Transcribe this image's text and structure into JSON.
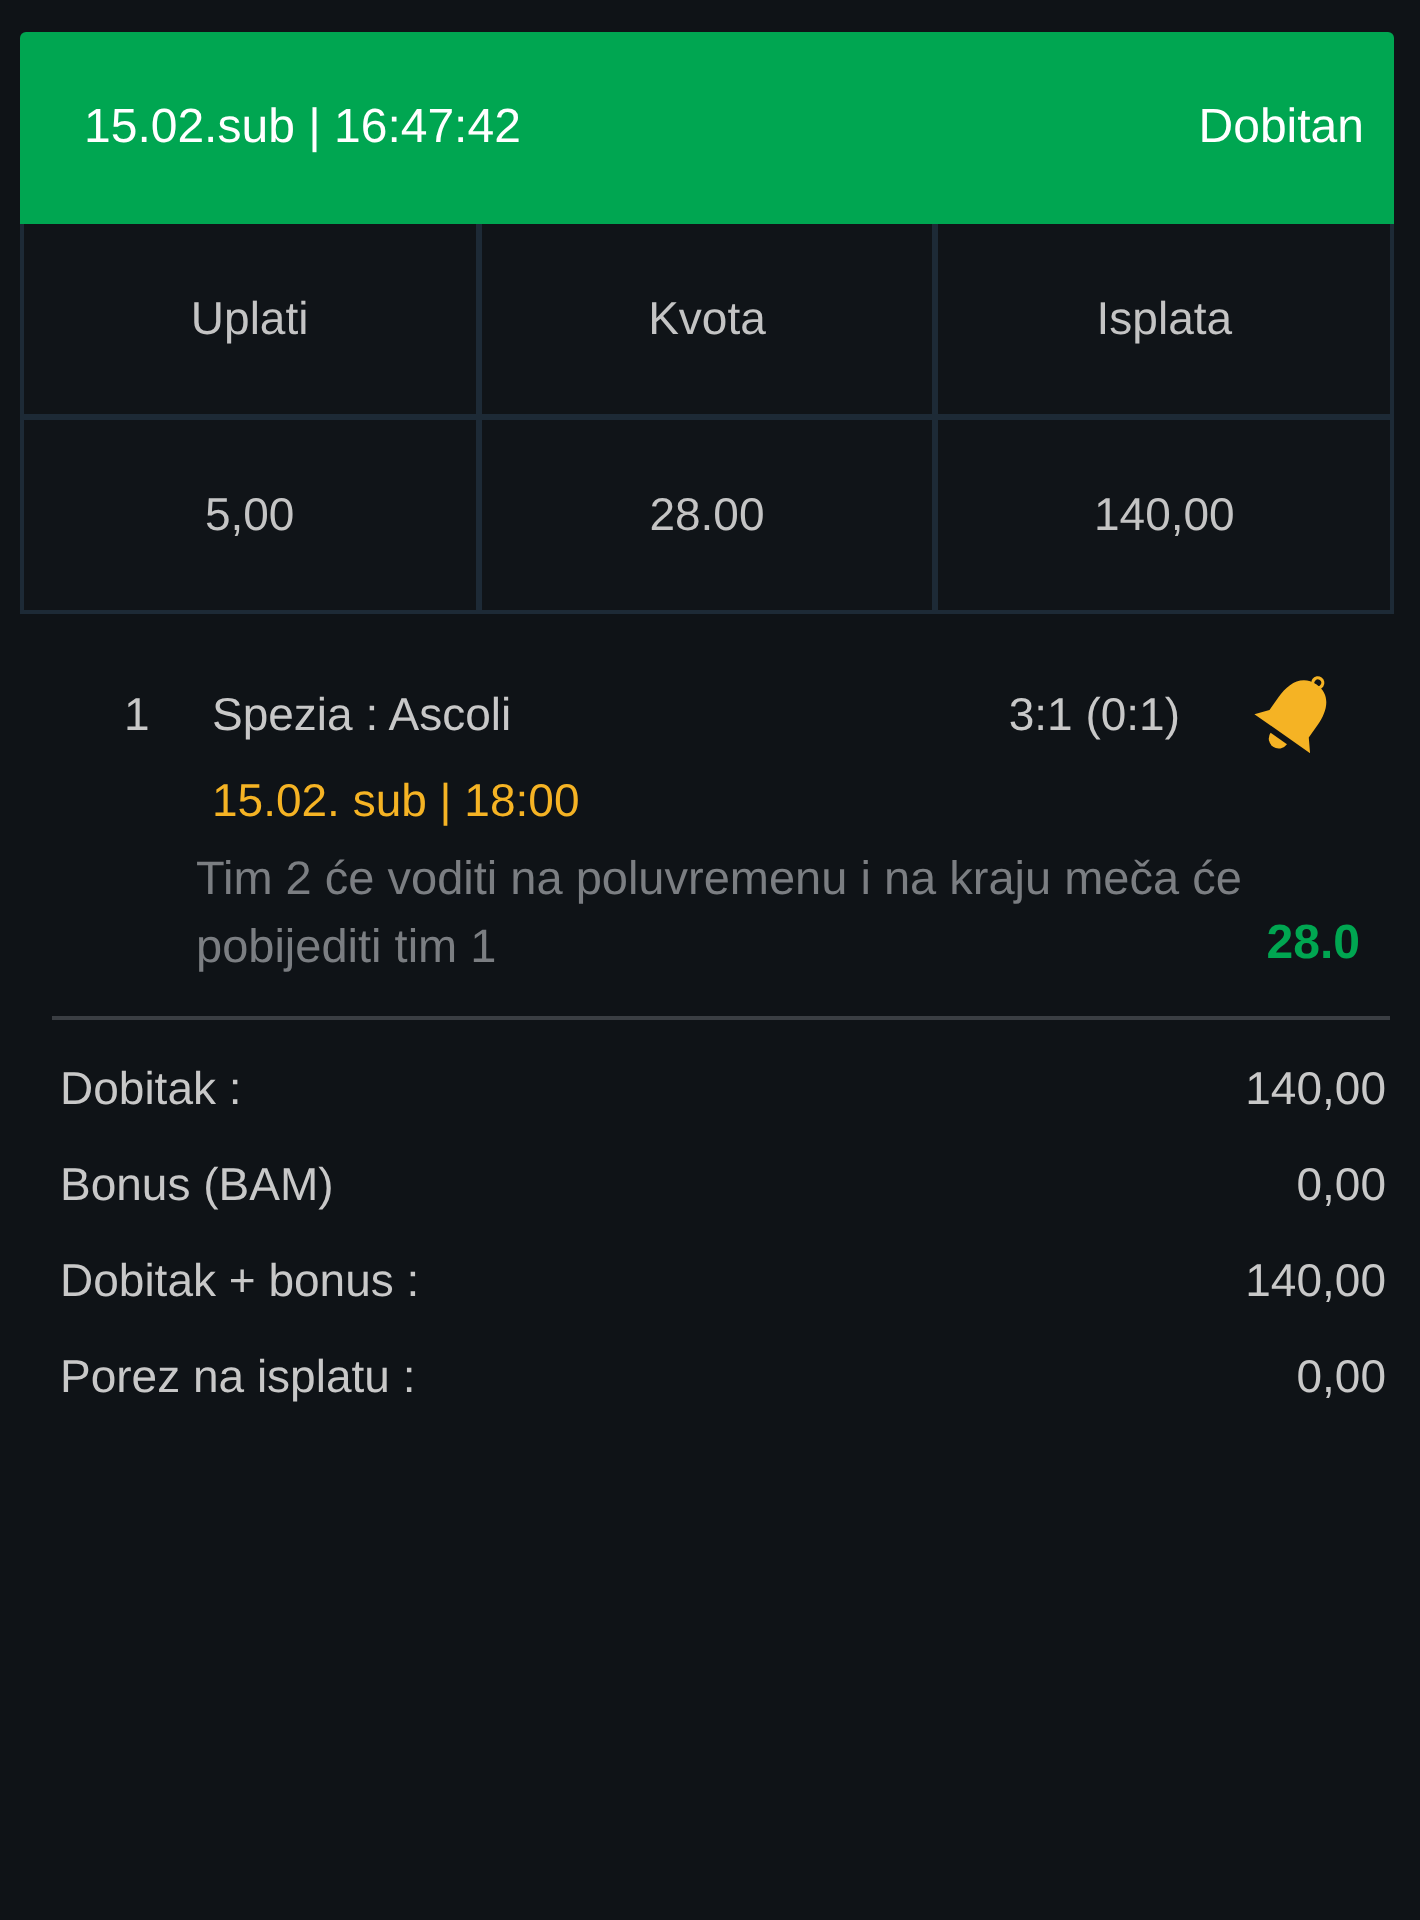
{
  "header": {
    "datetime": "15.02.sub | 16:47:42",
    "status": "Dobitan"
  },
  "summary_table": {
    "columns": [
      "Uplati",
      "Kvota",
      "Isplata"
    ],
    "values": [
      "5,00",
      "28.00",
      "140,00"
    ]
  },
  "events": [
    {
      "number": "1",
      "match": "Spezia : Ascoli",
      "result": "3:1 (0:1)",
      "start": "15.02. sub | 18:00",
      "pick": "Tim 2 će voditi na poluvremenu i na kraju meča će pobijediti tim 1",
      "odds": "28.0"
    }
  ],
  "totals": [
    {
      "label": "Dobitak :",
      "value": "140,00"
    },
    {
      "label": "Bonus (BAM)",
      "value": "0,00"
    },
    {
      "label": "Dobitak + bonus :",
      "value": "140,00"
    },
    {
      "label": "Porez na isplatu :",
      "value": "0,00"
    }
  ]
}
